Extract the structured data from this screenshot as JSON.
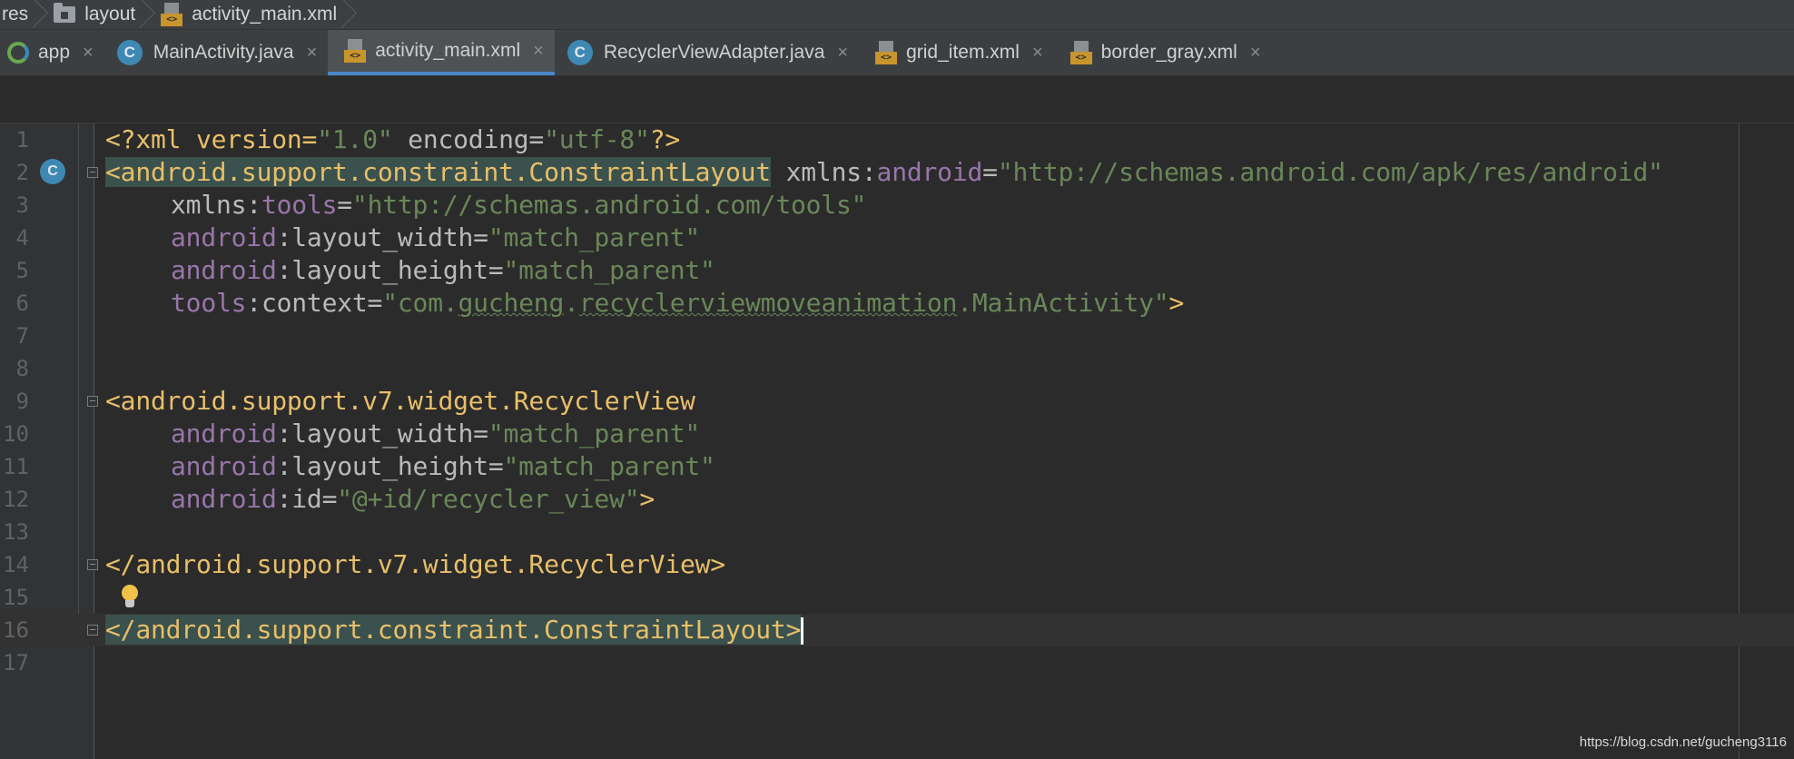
{
  "breadcrumb": {
    "items": [
      {
        "label": "res",
        "icon": "none"
      },
      {
        "label": "layout",
        "icon": "folder-icon"
      },
      {
        "label": "activity_main.xml",
        "icon": "xml-file-icon"
      }
    ]
  },
  "tabs": [
    {
      "label": "app",
      "icon": "android-module-icon",
      "close": "×",
      "active": false
    },
    {
      "label": "MainActivity.java",
      "icon": "class-icon",
      "icon_letter": "C",
      "close": "×",
      "active": false
    },
    {
      "label": "activity_main.xml",
      "icon": "xml-file-icon",
      "close": "×",
      "active": true
    },
    {
      "label": "RecyclerViewAdapter.java",
      "icon": "class-icon",
      "icon_letter": "C",
      "close": "×",
      "active": false
    },
    {
      "label": "grid_item.xml",
      "icon": "xml-file-icon",
      "close": "×",
      "active": false
    },
    {
      "label": "border_gray.xml",
      "icon": "xml-file-icon",
      "close": "×",
      "active": false
    }
  ],
  "xml_icon_text": "<>",
  "editor": {
    "gutter_marker_letter": "C",
    "line_numbers": [
      "1",
      "2",
      "3",
      "4",
      "5",
      "6",
      "7",
      "8",
      "9",
      "10",
      "11",
      "12",
      "13",
      "14",
      "15",
      "16",
      "17"
    ],
    "code": {
      "l1": {
        "a": "<?xml version=",
        "b": "\"1.0\"",
        "c": " encoding=",
        "d": "\"utf-8\"",
        "e": "?>"
      },
      "l2": {
        "tag": "<android.support.constraint.ConstraintLayout",
        "attr": " xmlns:",
        "ns": "android",
        "eq": "=",
        "val": "\"http://schemas.android.com/apk/res/android\""
      },
      "l3": {
        "attr": "xmlns:",
        "ns": "tools",
        "eq": "=",
        "val": "\"http://schemas.android.com/tools\""
      },
      "l4": {
        "ns": "android",
        "attr": ":layout_width=",
        "val": "\"match_parent\""
      },
      "l5": {
        "ns": "android",
        "attr": ":layout_height=",
        "val": "\"match_parent\""
      },
      "l6": {
        "ns": "tools",
        "attr": ":context=",
        "val1": "\"com.",
        "val2": "gucheng",
        "val3": ".",
        "val4": "recyclerviewmoveanimation",
        "val5": ".MainActivity\"",
        "tag": ">"
      },
      "l9": {
        "tag": "<android.support.v7.widget.RecyclerView"
      },
      "l10": {
        "ns": "android",
        "attr": ":layout_width=",
        "val": "\"match_parent\""
      },
      "l11": {
        "ns": "android",
        "attr": ":layout_height=",
        "val": "\"match_parent\""
      },
      "l12": {
        "ns": "android",
        "attr": ":id=",
        "val": "\"@+id/recycler_view\"",
        "tag": ">"
      },
      "l14": {
        "tag": "</android.support.v7.widget.RecyclerView>"
      },
      "l16": {
        "tag": "</android.support.constraint.ConstraintLayout>"
      }
    }
  },
  "watermark": "https://blog.csdn.net/gucheng3116",
  "colors": {
    "background": "#2b2b2b",
    "tag": "#e8bf6a",
    "namespace": "#9876aa",
    "string": "#6a8759",
    "attribute": "#bababa",
    "active_tab_underline": "#4a88c7",
    "class_icon": "#3d89b4"
  }
}
